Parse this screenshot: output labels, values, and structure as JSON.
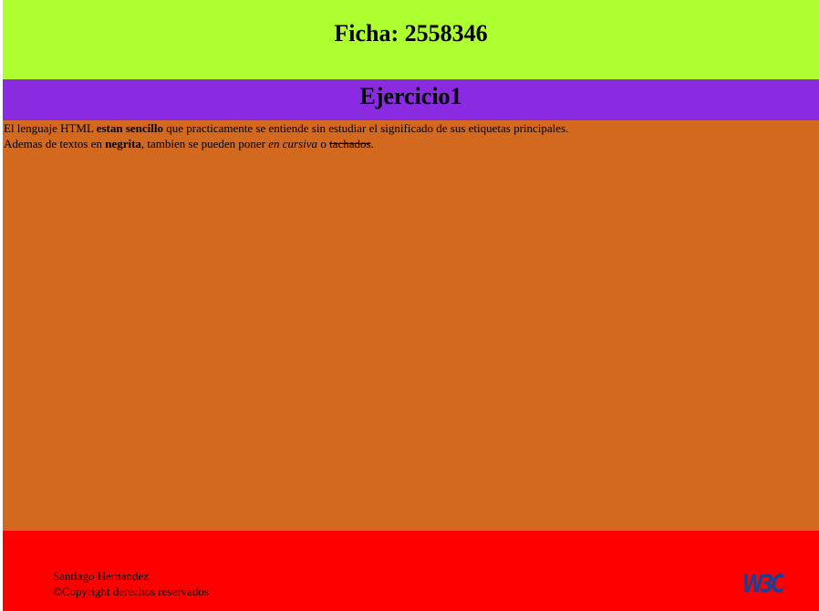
{
  "header": {
    "title": "Ficha: 2558346"
  },
  "section": {
    "title": "Ejercicio1"
  },
  "content": {
    "paragraph1": {
      "text_before": "El lenguaje HTML ",
      "bold": "estan sencillo",
      "text_after": " que practicamente se entiende sin estudiar el significado de sus etiquetas principales."
    },
    "paragraph2": {
      "text_before": "Ademas de textos en ",
      "bold": "negrita",
      "text_middle": ", tambien se pueden poner ",
      "italic": "en cursiva",
      "text_or": " o ",
      "strike": "tachados",
      "text_end": "."
    }
  },
  "footer": {
    "author": "Santiago Hernandez",
    "copyright": "©Copyright derechos reservados",
    "logo": "W3C"
  },
  "colors": {
    "header_bg": "#adff2f",
    "title_bg": "#8a2be2",
    "content_bg": "#d2691e",
    "footer_bg": "#ff0000"
  }
}
